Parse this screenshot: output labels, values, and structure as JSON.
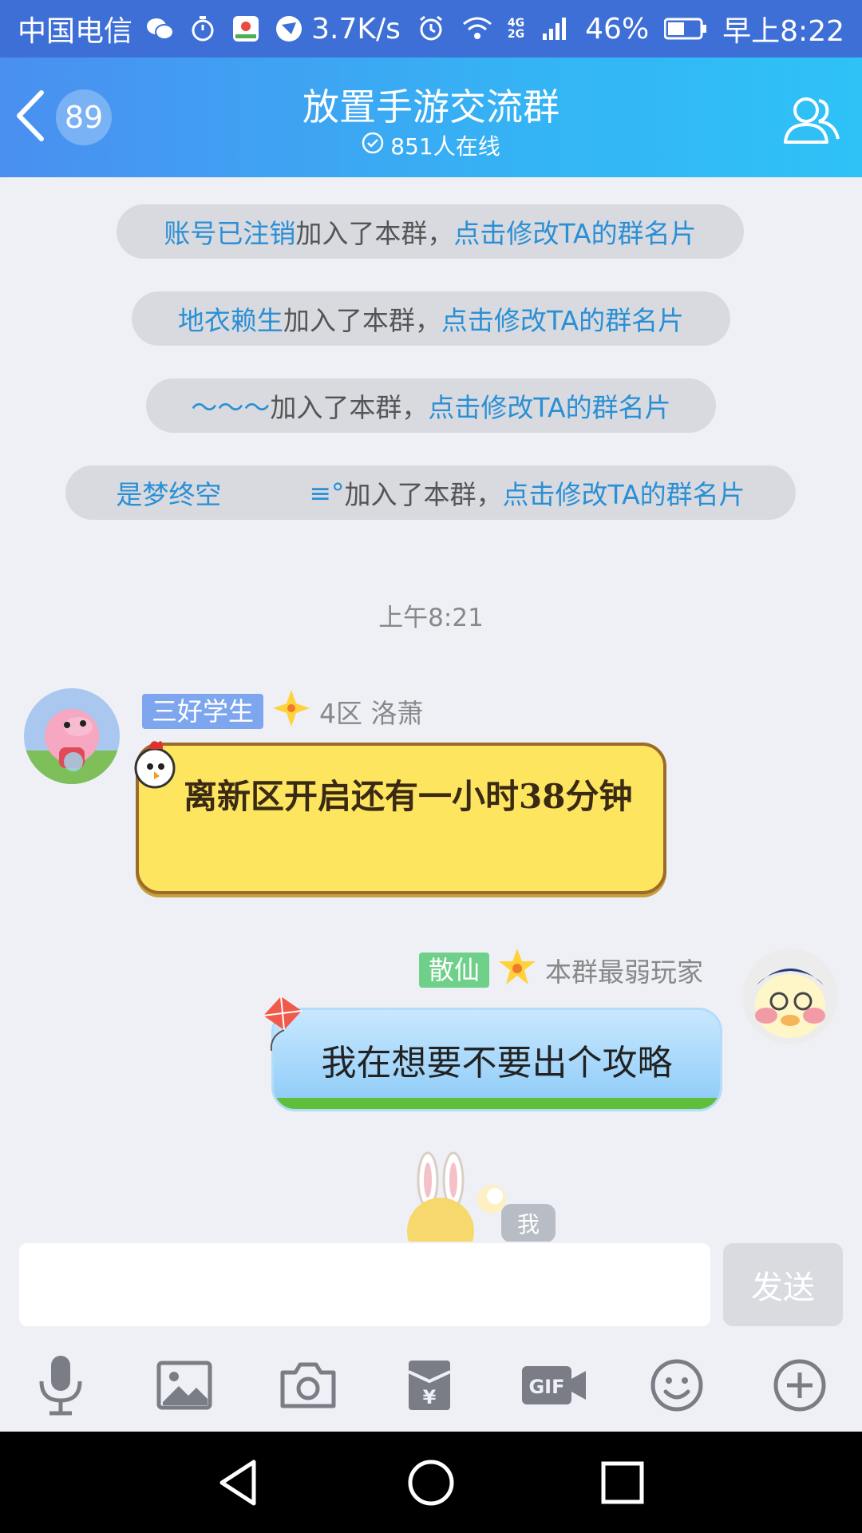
{
  "status_bar": {
    "carrier": "中国电信",
    "speed": "3.7K/s",
    "net_small_top": "4G",
    "net_small_bottom": "2G",
    "battery": "46%",
    "time": "早上8:22"
  },
  "header": {
    "unread_count": "89",
    "title": "放置手游交流群",
    "online": "851人在线"
  },
  "notices": [
    {
      "name": "账号已注销",
      "text": " 加入了本群，",
      "link": "点击修改TA的群名片"
    },
    {
      "name": "地衣赖生",
      "text": " 加入了本群，",
      "link": "点击修改TA的群名片"
    },
    {
      "name": "～～～",
      "text": " 加入了本群，",
      "link": "点击修改TA的群名片"
    },
    {
      "name": "是梦终空",
      "name2": "≡°",
      "text": " 加入了本群，",
      "link": "点击修改TA的群名片"
    }
  ],
  "timestamp": "上午8:21",
  "messages": [
    {
      "title_tag": "三好学生",
      "title_tag_color": "#7ea6ef",
      "sender": "4区 洛萧",
      "text": "离新区开启还有一小时38分钟"
    },
    {
      "title_tag": "散仙",
      "title_tag_color": "#6fd08a",
      "sender": "本群最弱玩家",
      "text": "我在想要不要出个攻略"
    }
  ],
  "me_label": "我",
  "input": {
    "placeholder": "",
    "send_label": "发送"
  },
  "toolbar": [
    "mic-icon",
    "image-icon",
    "camera-icon",
    "red-packet-icon",
    "gif-icon",
    "emoji-icon",
    "plus-icon"
  ],
  "colors": {
    "status_bar": "#3e6fd6",
    "header_start": "#4a8ff0",
    "header_end": "#2ec2f7",
    "link": "#2a8fd4",
    "background": "#eef0f6"
  }
}
